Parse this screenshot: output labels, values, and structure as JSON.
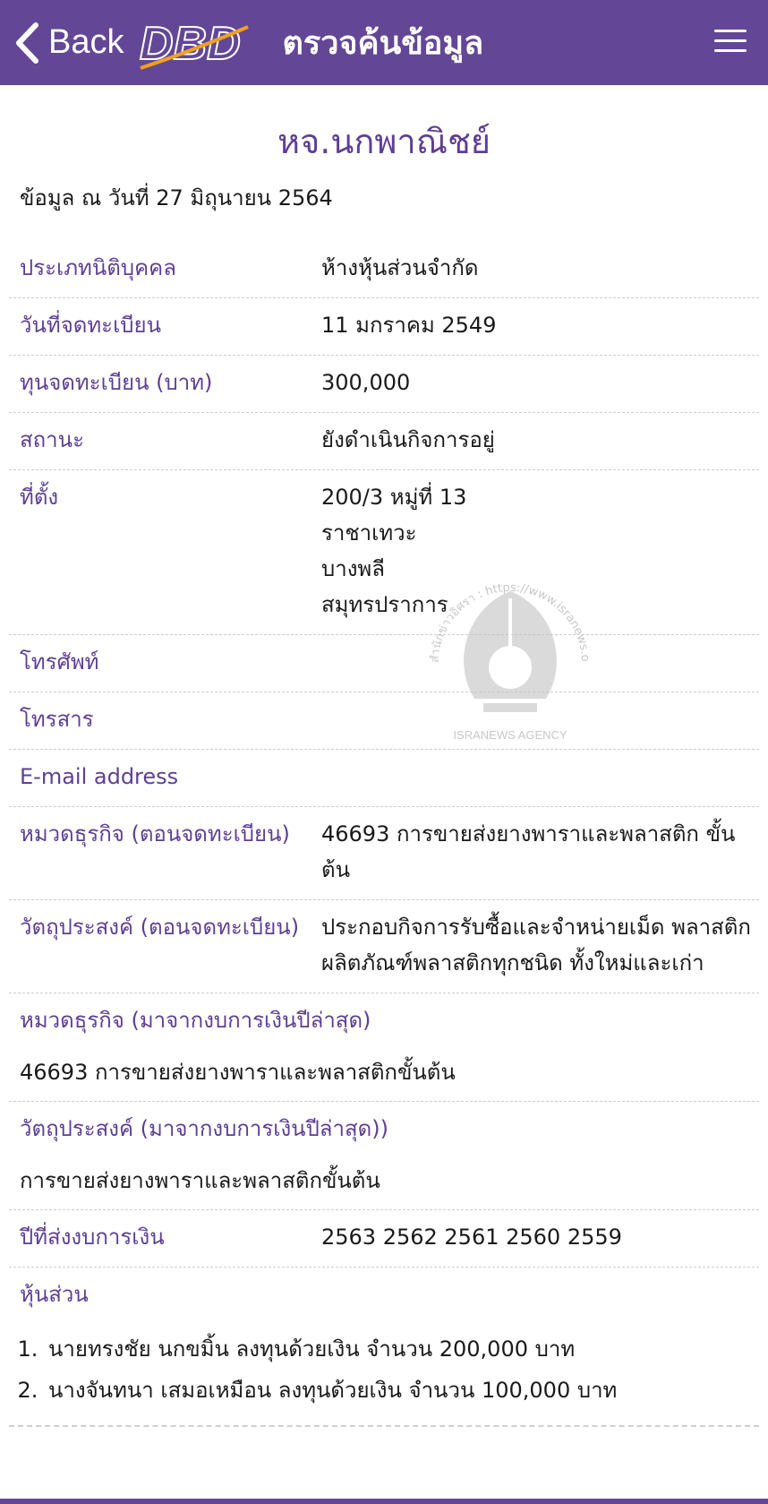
{
  "header": {
    "back_label": "Back",
    "logo_text": "DBD",
    "title": "ตรวจค้นข้อมูล"
  },
  "company_name": "หจ.นกพาณิชย์",
  "as_of": "ข้อมูล ณ วันที่ 27 มิถุนายน 2564",
  "fields": [
    {
      "label": "ประเภทนิติบุคคล",
      "value": "ห้างหุ้นส่วนจำกัด"
    },
    {
      "label": "วันที่จดทะเบียน",
      "value": "11 มกราคม 2549"
    },
    {
      "label": "ทุนจดทะเบียน (บาท)",
      "value": "300,000"
    },
    {
      "label": "สถานะ",
      "value": "ยังดำเนินกิจการอยู่"
    },
    {
      "label": "ที่ตั้ง",
      "value": "200/3 หมู่ที่ 13\nราชาเทวะ\nบางพลี\nสมุทรปราการ"
    },
    {
      "label": "โทรศัพท์",
      "value": ""
    },
    {
      "label": "โทรสาร",
      "value": ""
    },
    {
      "label": "E-mail address",
      "value": ""
    },
    {
      "label": "หมวดธุรกิจ (ตอนจดทะเบียน)",
      "value": "46693 การขายส่งยางพาราและพลาสติก ขั้นต้น"
    },
    {
      "label": "วัตถุประสงค์ (ตอนจดทะเบียน)",
      "value": "ประกอบกิจการรับซื้อและจำหน่ายเม็ด พลาสติก ผลิตภัณฑ์พลาสติกทุกชนิด ทั้งใหม่และเก่า"
    }
  ],
  "latest_business_category": {
    "label": "หมวดธุรกิจ (มาจากงบการเงินปีล่าสุด)",
    "value": "46693 การขายส่งยางพาราและพลาสติกขั้นต้น"
  },
  "latest_objective": {
    "label": "วัตถุประสงค์ (มาจากงบการเงินปีล่าสุด))",
    "value": "การขายส่งยางพาราและพลาสติกขั้นต้น"
  },
  "financial_years": {
    "label": "ปีที่ส่งงบการเงิน",
    "value": "2563 2562 2561 2560 2559"
  },
  "partners": {
    "label": "หุ้นส่วน",
    "items": [
      "นายทรงชัย นกขมิ้น ลงทุนด้วยเงิน จำนวน 200,000 บาท",
      "นางจันทนา เสมอเหมือน ลงทุนด้วยเงิน จำนวน 100,000 บาท"
    ]
  },
  "watermark": {
    "arc_text": "สำนักข่าวอิศรา : https://www.isranews.org",
    "caption": "ISRANEWS AGENCY"
  },
  "colors": {
    "brand_purple": "#634796",
    "label_purple": "#5e3f93",
    "logo_orange": "#f0a020"
  }
}
